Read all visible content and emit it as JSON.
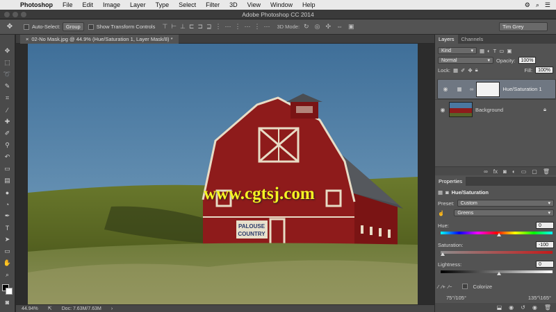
{
  "menubar": {
    "app": "Photoshop",
    "items": [
      "File",
      "Edit",
      "Image",
      "Layer",
      "Type",
      "Select",
      "Filter",
      "3D",
      "View",
      "Window",
      "Help"
    ]
  },
  "window": {
    "title": "Adobe Photoshop CC 2014"
  },
  "options": {
    "auto_select_label": "Auto-Select:",
    "auto_select_value": "Group",
    "transform_label": "Show Transform Controls",
    "mode3d_label": "3D Mode:",
    "user": "Tim Grey"
  },
  "document": {
    "tab_title": "02-No Mask.jpg @ 44.9% (Hue/Saturation 1, Layer Mask/8) *",
    "sign_line1": "PALOUSE",
    "sign_line2": "COUNTRY",
    "watermark": "www.cgtsj.com"
  },
  "status": {
    "zoom": "44.94%",
    "doc": "Doc: 7.63M/7.63M"
  },
  "layers_panel": {
    "tabs": [
      "Layers",
      "Channels"
    ],
    "kind": "Kind",
    "blend_mode": "Normal",
    "opacity_label": "Opacity:",
    "opacity_value": "100%",
    "lock_label": "Lock:",
    "fill_label": "Fill:",
    "fill_value": "100%",
    "layers": [
      {
        "name": "Hue/Saturation 1",
        "selected": true
      },
      {
        "name": "Background",
        "selected": false
      }
    ]
  },
  "properties": {
    "tab": "Properties",
    "title": "Hue/Saturation",
    "preset_label": "Preset:",
    "preset_value": "Custom",
    "range_value": "Greens",
    "hue_label": "Hue:",
    "hue_value": "0",
    "saturation_label": "Saturation:",
    "saturation_value": "-100",
    "lightness_label": "Lightness:",
    "lightness_value": "0",
    "colorize_label": "Colorize",
    "range_left": "75°/105°",
    "range_right": "135°\\165°"
  }
}
